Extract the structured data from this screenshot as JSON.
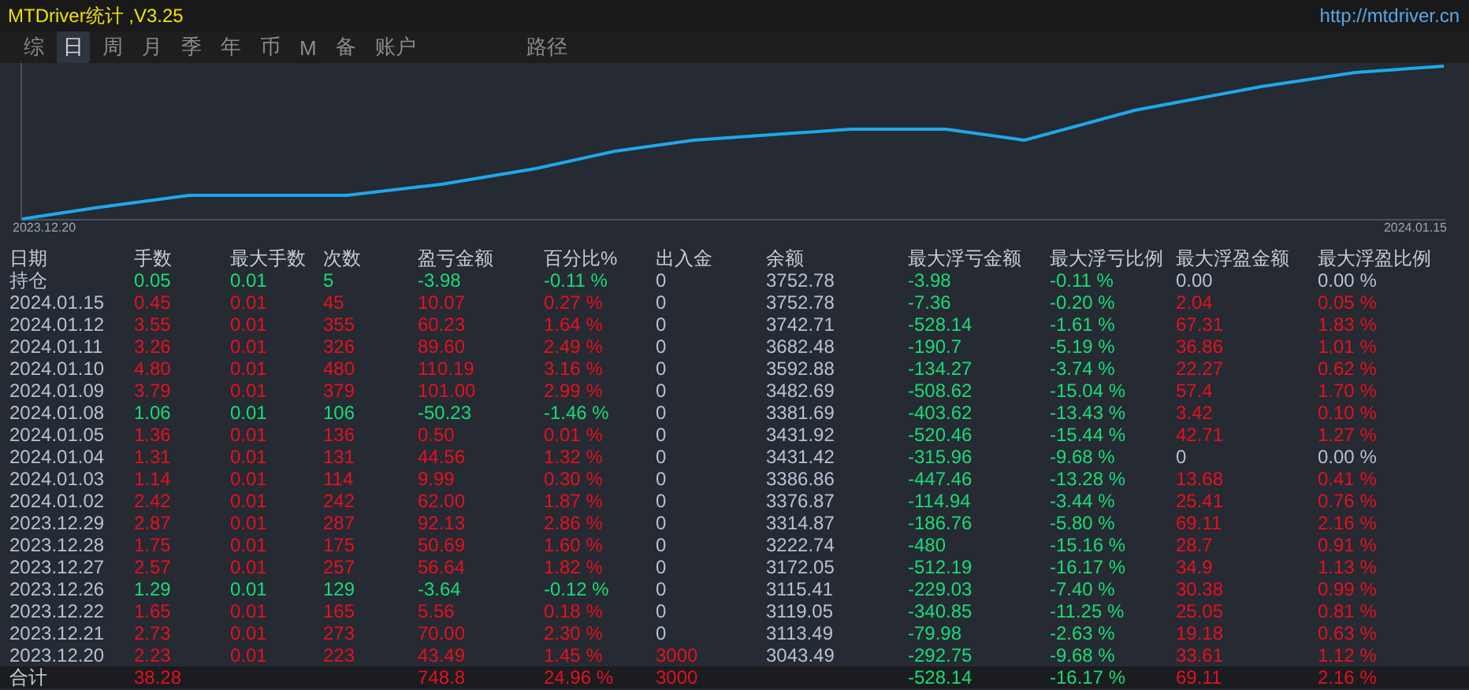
{
  "window": {
    "title": "MTDriver统计 ,V3.25",
    "link": "http://mtdriver.cn"
  },
  "tabs": [
    {
      "label": "综",
      "selected": false
    },
    {
      "label": "日",
      "selected": true
    },
    {
      "label": "周",
      "selected": false
    },
    {
      "label": "月",
      "selected": false
    },
    {
      "label": "季",
      "selected": false
    },
    {
      "label": "年",
      "selected": false
    },
    {
      "label": "币",
      "selected": false
    },
    {
      "label": "M",
      "selected": false
    },
    {
      "label": "备",
      "selected": false
    },
    {
      "label": "账户",
      "selected": false
    }
  ],
  "path_tab": {
    "label": "路径"
  },
  "chart": {
    "start_label": "2023.12.20",
    "end_label": "2024.01.15"
  },
  "table": {
    "columns": [
      "日期",
      "手数",
      "最大手数",
      "次数",
      "盈亏金额",
      "百分比%",
      "出入金",
      "余额",
      "最大浮亏金额",
      "最大浮亏比例",
      "最大浮盈金额",
      "最大浮盈比例"
    ],
    "rows": [
      {
        "date": "持仓",
        "lots": "0.05",
        "max_lots": "0.01",
        "count": "5",
        "pnl": "-3.98",
        "pct": "-0.11 %",
        "deposit": "0",
        "balance": "3752.78",
        "max_float_loss": "-3.98",
        "max_float_loss_pct": "-0.11 %",
        "max_float_gain": "0.00",
        "max_float_gain_pct": "0.00 %",
        "kind": "loss",
        "float_gain": false,
        "deposit_marked": false
      },
      {
        "date": "2024.01.15",
        "lots": "0.45",
        "max_lots": "0.01",
        "count": "45",
        "pnl": "10.07",
        "pct": "0.27 %",
        "deposit": "0",
        "balance": "3752.78",
        "max_float_loss": "-7.36",
        "max_float_loss_pct": "-0.20 %",
        "max_float_gain": "2.04",
        "max_float_gain_pct": "0.05 %",
        "kind": "gain",
        "float_gain": true,
        "deposit_marked": false
      },
      {
        "date": "2024.01.12",
        "lots": "3.55",
        "max_lots": "0.01",
        "count": "355",
        "pnl": "60.23",
        "pct": "1.64 %",
        "deposit": "0",
        "balance": "3742.71",
        "max_float_loss": "-528.14",
        "max_float_loss_pct": "-1.61 %",
        "max_float_gain": "67.31",
        "max_float_gain_pct": "1.83 %",
        "kind": "gain",
        "float_gain": true,
        "deposit_marked": false
      },
      {
        "date": "2024.01.11",
        "lots": "3.26",
        "max_lots": "0.01",
        "count": "326",
        "pnl": "89.60",
        "pct": "2.49 %",
        "deposit": "0",
        "balance": "3682.48",
        "max_float_loss": "-190.7",
        "max_float_loss_pct": "-5.19 %",
        "max_float_gain": "36.86",
        "max_float_gain_pct": "1.01 %",
        "kind": "gain",
        "float_gain": true,
        "deposit_marked": false
      },
      {
        "date": "2024.01.10",
        "lots": "4.80",
        "max_lots": "0.01",
        "count": "480",
        "pnl": "110.19",
        "pct": "3.16 %",
        "deposit": "0",
        "balance": "3592.88",
        "max_float_loss": "-134.27",
        "max_float_loss_pct": "-3.74 %",
        "max_float_gain": "22.27",
        "max_float_gain_pct": "0.62 %",
        "kind": "gain",
        "float_gain": true,
        "deposit_marked": false
      },
      {
        "date": "2024.01.09",
        "lots": "3.79",
        "max_lots": "0.01",
        "count": "379",
        "pnl": "101.00",
        "pct": "2.99 %",
        "deposit": "0",
        "balance": "3482.69",
        "max_float_loss": "-508.62",
        "max_float_loss_pct": "-15.04 %",
        "max_float_gain": "57.4",
        "max_float_gain_pct": "1.70 %",
        "kind": "gain",
        "float_gain": true,
        "deposit_marked": false
      },
      {
        "date": "2024.01.08",
        "lots": "1.06",
        "max_lots": "0.01",
        "count": "106",
        "pnl": "-50.23",
        "pct": "-1.46 %",
        "deposit": "0",
        "balance": "3381.69",
        "max_float_loss": "-403.62",
        "max_float_loss_pct": "-13.43 %",
        "max_float_gain": "3.42",
        "max_float_gain_pct": "0.10 %",
        "kind": "loss",
        "float_gain": true,
        "deposit_marked": false
      },
      {
        "date": "2024.01.05",
        "lots": "1.36",
        "max_lots": "0.01",
        "count": "136",
        "pnl": "0.50",
        "pct": "0.01 %",
        "deposit": "0",
        "balance": "3431.92",
        "max_float_loss": "-520.46",
        "max_float_loss_pct": "-15.44 %",
        "max_float_gain": "42.71",
        "max_float_gain_pct": "1.27 %",
        "kind": "gain",
        "float_gain": true,
        "deposit_marked": false
      },
      {
        "date": "2024.01.04",
        "lots": "1.31",
        "max_lots": "0.01",
        "count": "131",
        "pnl": "44.56",
        "pct": "1.32 %",
        "deposit": "0",
        "balance": "3431.42",
        "max_float_loss": "-315.96",
        "max_float_loss_pct": "-9.68 %",
        "max_float_gain": "0",
        "max_float_gain_pct": "0.00 %",
        "kind": "gain",
        "float_gain": false,
        "deposit_marked": false
      },
      {
        "date": "2024.01.03",
        "lots": "1.14",
        "max_lots": "0.01",
        "count": "114",
        "pnl": "9.99",
        "pct": "0.30 %",
        "deposit": "0",
        "balance": "3386.86",
        "max_float_loss": "-447.46",
        "max_float_loss_pct": "-13.28 %",
        "max_float_gain": "13.68",
        "max_float_gain_pct": "0.41 %",
        "kind": "gain",
        "float_gain": true,
        "deposit_marked": false
      },
      {
        "date": "2024.01.02",
        "lots": "2.42",
        "max_lots": "0.01",
        "count": "242",
        "pnl": "62.00",
        "pct": "1.87 %",
        "deposit": "0",
        "balance": "3376.87",
        "max_float_loss": "-114.94",
        "max_float_loss_pct": "-3.44 %",
        "max_float_gain": "25.41",
        "max_float_gain_pct": "0.76 %",
        "kind": "gain",
        "float_gain": true,
        "deposit_marked": false
      },
      {
        "date": "2023.12.29",
        "lots": "2.87",
        "max_lots": "0.01",
        "count": "287",
        "pnl": "92.13",
        "pct": "2.86 %",
        "deposit": "0",
        "balance": "3314.87",
        "max_float_loss": "-186.76",
        "max_float_loss_pct": "-5.80 %",
        "max_float_gain": "69.11",
        "max_float_gain_pct": "2.16 %",
        "kind": "gain",
        "float_gain": true,
        "deposit_marked": false
      },
      {
        "date": "2023.12.28",
        "lots": "1.75",
        "max_lots": "0.01",
        "count": "175",
        "pnl": "50.69",
        "pct": "1.60 %",
        "deposit": "0",
        "balance": "3222.74",
        "max_float_loss": "-480",
        "max_float_loss_pct": "-15.16 %",
        "max_float_gain": "28.7",
        "max_float_gain_pct": "0.91 %",
        "kind": "gain",
        "float_gain": true,
        "deposit_marked": false
      },
      {
        "date": "2023.12.27",
        "lots": "2.57",
        "max_lots": "0.01",
        "count": "257",
        "pnl": "56.64",
        "pct": "1.82 %",
        "deposit": "0",
        "balance": "3172.05",
        "max_float_loss": "-512.19",
        "max_float_loss_pct": "-16.17 %",
        "max_float_gain": "34.9",
        "max_float_gain_pct": "1.13 %",
        "kind": "gain",
        "float_gain": true,
        "deposit_marked": false
      },
      {
        "date": "2023.12.26",
        "lots": "1.29",
        "max_lots": "0.01",
        "count": "129",
        "pnl": "-3.64",
        "pct": "-0.12 %",
        "deposit": "0",
        "balance": "3115.41",
        "max_float_loss": "-229.03",
        "max_float_loss_pct": "-7.40 %",
        "max_float_gain": "30.38",
        "max_float_gain_pct": "0.99 %",
        "kind": "loss",
        "float_gain": true,
        "deposit_marked": false
      },
      {
        "date": "2023.12.22",
        "lots": "1.65",
        "max_lots": "0.01",
        "count": "165",
        "pnl": "5.56",
        "pct": "0.18 %",
        "deposit": "0",
        "balance": "3119.05",
        "max_float_loss": "-340.85",
        "max_float_loss_pct": "-11.25 %",
        "max_float_gain": "25.05",
        "max_float_gain_pct": "0.81 %",
        "kind": "gain",
        "float_gain": true,
        "deposit_marked": false
      },
      {
        "date": "2023.12.21",
        "lots": "2.73",
        "max_lots": "0.01",
        "count": "273",
        "pnl": "70.00",
        "pct": "2.30 %",
        "deposit": "0",
        "balance": "3113.49",
        "max_float_loss": "-79.98",
        "max_float_loss_pct": "-2.63 %",
        "max_float_gain": "19.18",
        "max_float_gain_pct": "0.63 %",
        "kind": "gain",
        "float_gain": true,
        "deposit_marked": false
      },
      {
        "date": "2023.12.20",
        "lots": "2.23",
        "max_lots": "0.01",
        "count": "223",
        "pnl": "43.49",
        "pct": "1.45 %",
        "deposit": "3000",
        "balance": "3043.49",
        "max_float_loss": "-292.75",
        "max_float_loss_pct": "-9.68 %",
        "max_float_gain": "33.61",
        "max_float_gain_pct": "1.12 %",
        "kind": "gain",
        "float_gain": true,
        "deposit_marked": true
      }
    ],
    "total": {
      "date": "合计",
      "lots": "38.28",
      "pnl": "748.8",
      "pct": "24.96 %",
      "deposit": "3000",
      "max_float_loss": "-528.14",
      "max_float_loss_pct": "-16.17 %",
      "max_float_gain": "69.11",
      "max_float_gain_pct": "2.16 %",
      "kind": "gain",
      "float_gain": true,
      "deposit_marked": true
    }
  }
}
